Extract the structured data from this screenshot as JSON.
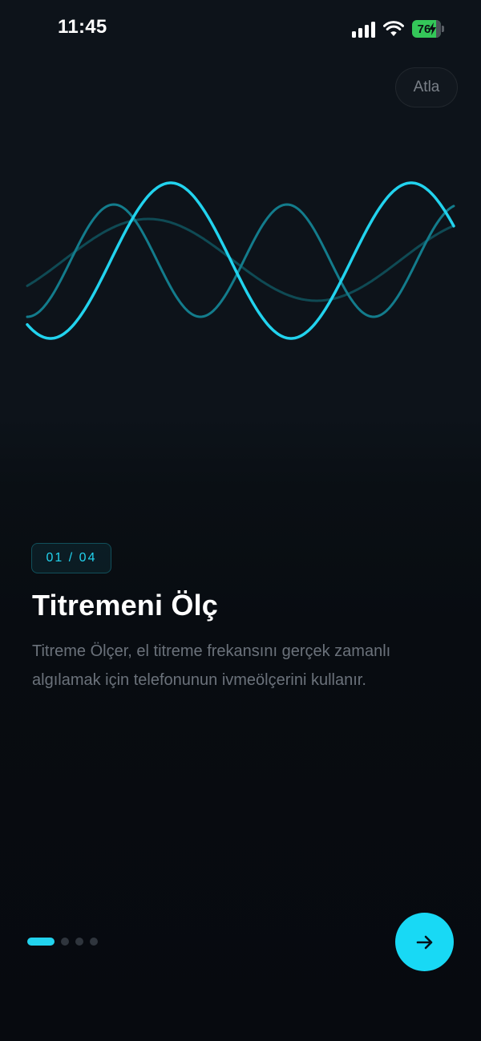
{
  "status_bar": {
    "time": "11:45",
    "battery_level": "76",
    "icons": [
      "signal-icon",
      "wifi-icon",
      "battery-charging-icon"
    ]
  },
  "header": {
    "skip_label": "Atla"
  },
  "illustration": {
    "icon": "sine-wave-illustration",
    "colors": {
      "primary_wave": "#22d3ee",
      "secondary_wave": "#137c8c",
      "tertiary_wave": "#0f4a54"
    }
  },
  "content": {
    "step_label": "01 / 04",
    "title": "Titremeni Ölç",
    "description": "Titreme Ölçer, el titreme frekansını gerçek zamanlı algılamak için telefonunun ivmeölçerini kullanır."
  },
  "pagination": {
    "total": 4,
    "current": 1
  },
  "footer": {
    "next_icon": "arrow-right-icon"
  },
  "theme": {
    "accent": "#22d3ee",
    "background": "#080c11",
    "muted_text": "#6b727b"
  }
}
